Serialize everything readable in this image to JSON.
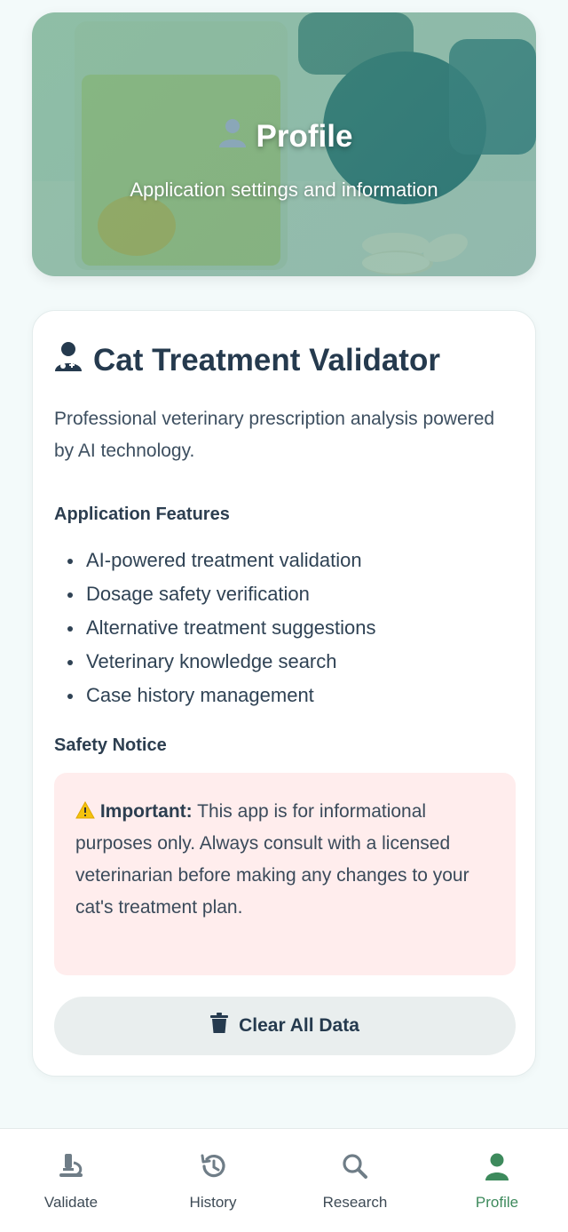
{
  "header": {
    "title": "Profile",
    "subtitle": "Application settings and information"
  },
  "card": {
    "title": "Cat Treatment Validator",
    "description": "Professional veterinary prescription analysis powered by AI technology.",
    "features_heading": "Application Features",
    "features": [
      "AI-powered treatment validation",
      "Dosage safety verification",
      "Alternative treatment suggestions",
      "Veterinary knowledge search",
      "Case history management"
    ],
    "safety_heading": "Safety Notice",
    "notice": {
      "bold": "Important:",
      "text": " This app is for informational purposes only. Always consult with a licensed veterinarian before making any changes to your cat's treatment plan."
    },
    "clear_button": "Clear All Data"
  },
  "nav": {
    "items": [
      {
        "label": "Validate",
        "icon": "microscope-icon",
        "active": false
      },
      {
        "label": "History",
        "icon": "history-icon",
        "active": false
      },
      {
        "label": "Research",
        "icon": "search-icon",
        "active": false
      },
      {
        "label": "Profile",
        "icon": "user-icon",
        "active": true
      }
    ]
  },
  "colors": {
    "accent": "#3d8a5c",
    "notice_bg": "#ffeded",
    "text_dark": "#253a4e"
  }
}
